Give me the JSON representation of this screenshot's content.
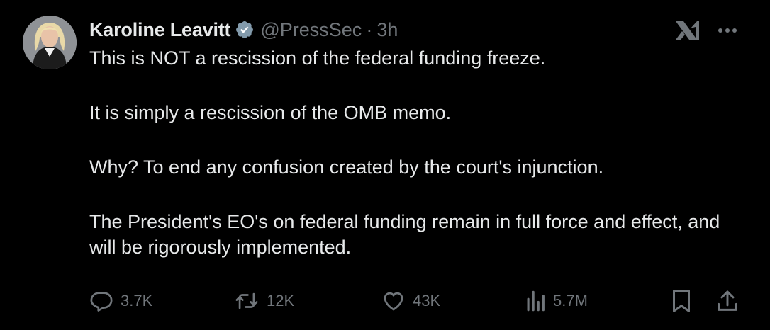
{
  "author": {
    "name": "Karoline Leavitt",
    "handle": "@PressSec",
    "separator": "·",
    "time": "3h",
    "verified_color": "#829aab"
  },
  "body": {
    "paragraphs": [
      "This is NOT a rescission of the federal funding freeze.",
      "It is simply a rescission of the OMB memo.",
      "Why? To end any confusion created by the court's injunction.",
      "The President's EO's on federal funding remain in full force and effect, and will be rigorously implemented."
    ]
  },
  "actions": {
    "replies": "3.7K",
    "reposts": "12K",
    "likes": "43K",
    "views": "5.7M"
  },
  "icons": {
    "reply": "speech-bubble-icon",
    "repost": "repost-arrows-icon",
    "like": "heart-icon",
    "views": "bar-chart-icon",
    "bookmark": "bookmark-icon",
    "share": "share-upload-icon",
    "grok": "grok-icon",
    "more": "more-dots-icon"
  },
  "colors": {
    "background": "#000000",
    "text": "#e7e9ea",
    "muted": "#71767b"
  }
}
